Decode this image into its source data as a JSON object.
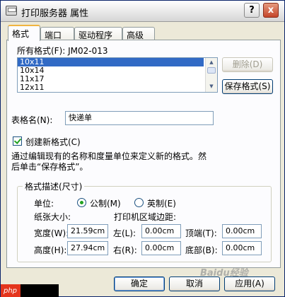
{
  "window": {
    "title": "打印服务器 属性",
    "help_glyph": "?",
    "close_glyph": "x"
  },
  "tabs": [
    {
      "label": "格式"
    },
    {
      "label": "端口"
    },
    {
      "label": "驱动程序"
    },
    {
      "label": "高级"
    }
  ],
  "formats": {
    "label": "所有格式(F): JM02-013",
    "items": [
      "10x11",
      "10x14",
      "11x17",
      "12x11"
    ],
    "selected_index": 0
  },
  "buttons": {
    "delete": "删除(D)",
    "save_format": "保存格式(S)",
    "ok": "确定",
    "cancel": "取消",
    "apply": "应用(A)"
  },
  "form_name": {
    "label": "表格名(N):",
    "value": "快递单"
  },
  "create_new": {
    "label": "创建新格式(C)",
    "checked": true
  },
  "instructions": {
    "line1": "通过编辑现有的名称和度量单位来定义新的格式。然",
    "line2": "后单击“保存格式”。"
  },
  "description": {
    "title": "格式描述(尺寸)",
    "unit_label": "单位:",
    "unit_metric": "公制(M)",
    "unit_english": "英制(E)",
    "unit_selected": "metric",
    "paper_size_label": "纸张大小:",
    "printer_area_label": "打印机区域边距:",
    "width_label": "宽度(W):",
    "width_value": "21.59cm",
    "height_label": "高度(H):",
    "height_value": "27.94cm",
    "left_label": "左(L):",
    "left_value": "0.00cm",
    "right_label": "右(R):",
    "right_value": "0.00cm",
    "top_label": "顶端(T):",
    "top_value": "0.00cm",
    "bottom_label": "底部(B):",
    "bottom_value": "0.00cm"
  },
  "watermark": {
    "text": "Baidu经验",
    "badge": "php"
  },
  "colors": {
    "selection": "#316ac5",
    "window_bg": "#ece9d8",
    "panel_bg": "#fcfcfe",
    "check": "#21a121"
  }
}
